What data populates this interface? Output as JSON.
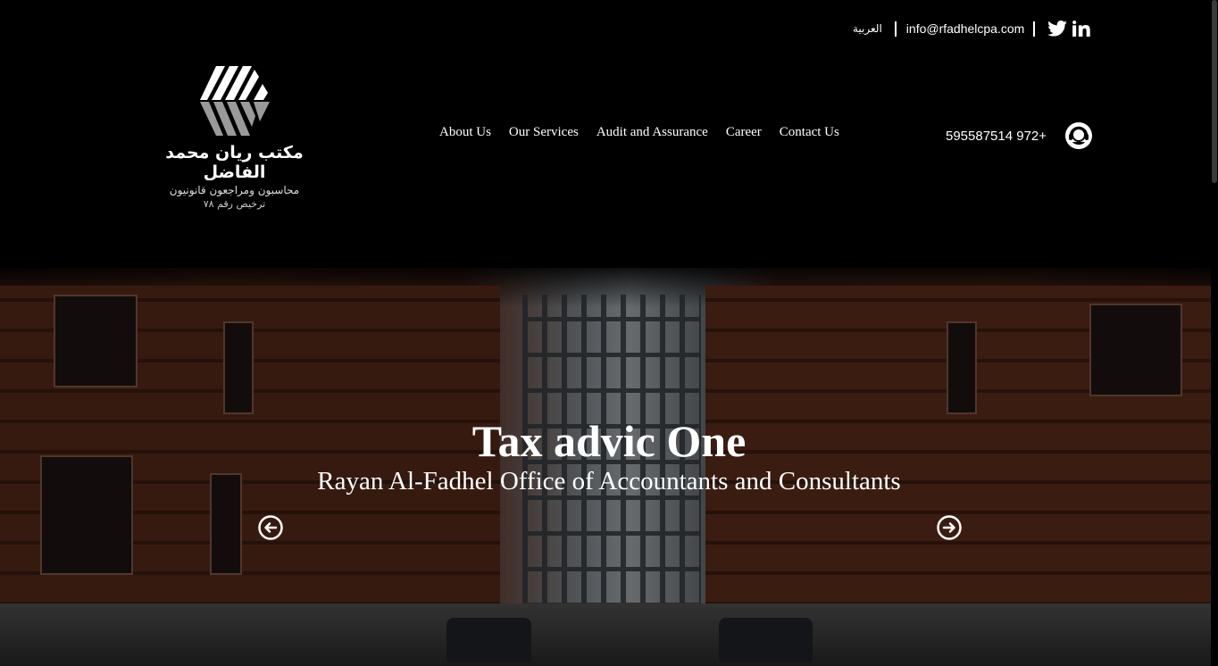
{
  "topbar": {
    "language_label": "العربية",
    "email": "info@rfadhelcpa.com",
    "social_icons": [
      "twitter-icon",
      "linkedin-icon"
    ]
  },
  "logo": {
    "title": "مكتب ريان محمد الفاضل",
    "subtitle": "محاسبون ومراجعون قانونيون",
    "license": "ترخيص رقم ٧٨"
  },
  "nav": {
    "items": [
      "About Us",
      "Our Services",
      "Audit and Assurance",
      "Career",
      "Contact Us"
    ]
  },
  "contact": {
    "phone": "595587514 972+"
  },
  "hero": {
    "title": "Tax advic One",
    "subtitle": "Rayan Al-Fadhel Office of Accountants and Consultants"
  },
  "colors": {
    "background": "#000000",
    "text": "#ffffff"
  }
}
